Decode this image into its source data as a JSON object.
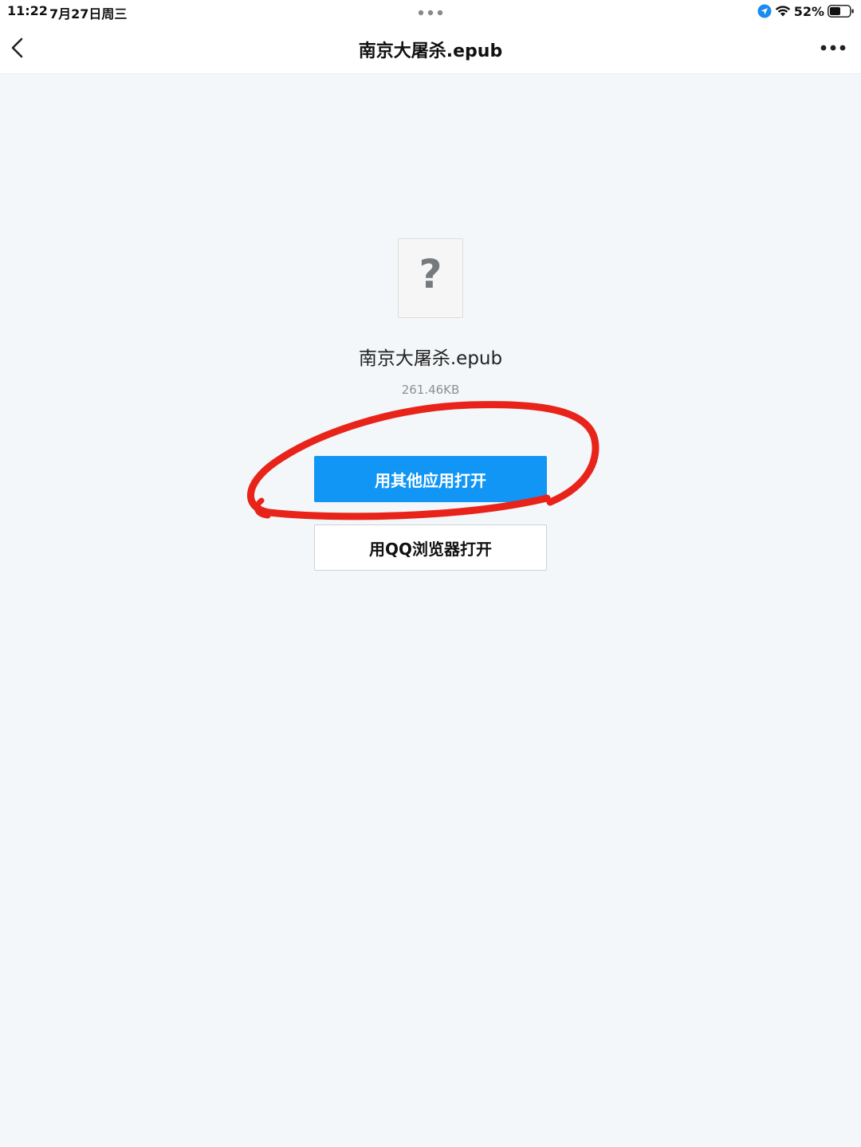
{
  "status_bar": {
    "time": "11:22",
    "date": "7月27日周三",
    "battery_percent": "52%",
    "icons": [
      "location-icon",
      "wifi-icon",
      "battery-icon"
    ]
  },
  "nav": {
    "back_icon": "chevron-left-icon",
    "title": "南京大屠杀.epub",
    "more_icon": "more-dots-icon"
  },
  "file": {
    "icon": "unknown-file-icon",
    "icon_glyph": "?",
    "name": "南京大屠杀.epub",
    "size": "261.46KB"
  },
  "actions": {
    "open_other_label": "用其他应用打开",
    "open_qq_label": "用QQ浏览器打开"
  },
  "colors": {
    "primary_button": "#1196f5",
    "annotation": "#e8241a",
    "background": "#f4f7f9",
    "location_badge": "#1a8cf0"
  }
}
